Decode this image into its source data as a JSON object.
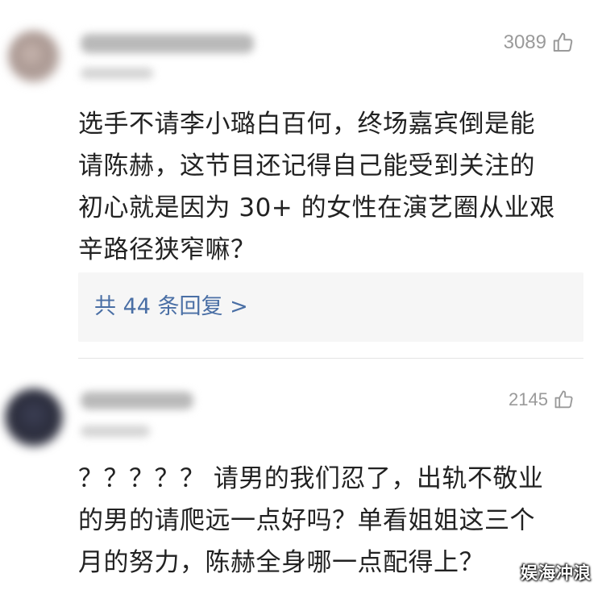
{
  "comments": [
    {
      "likes": "3089",
      "text": "选手不请李小璐白百何，终场嘉宾倒是能\n请陈赫，这节目还记得自己能受到关注的\n初心就是因为 30+ 的女性在演艺圈从业艰\n辛路径狭窄嘛？",
      "replies_label": "共 44 条回复 >"
    },
    {
      "likes": "2145",
      "text": "？？？？？ 请男的我们忍了，出轨不敬业\n的男的请爬远一点好吗？单看姐姐这三个\n月的努力，陈赫全身哪一点配得上？"
    }
  ],
  "icons": {
    "like": "thumbs-up-outline-icon"
  },
  "colors": {
    "link": "#4a6fa5",
    "muted": "#9a9a9a",
    "text": "#222222",
    "reply_bg": "#f6f6f6"
  },
  "watermark": "娱海冲浪"
}
